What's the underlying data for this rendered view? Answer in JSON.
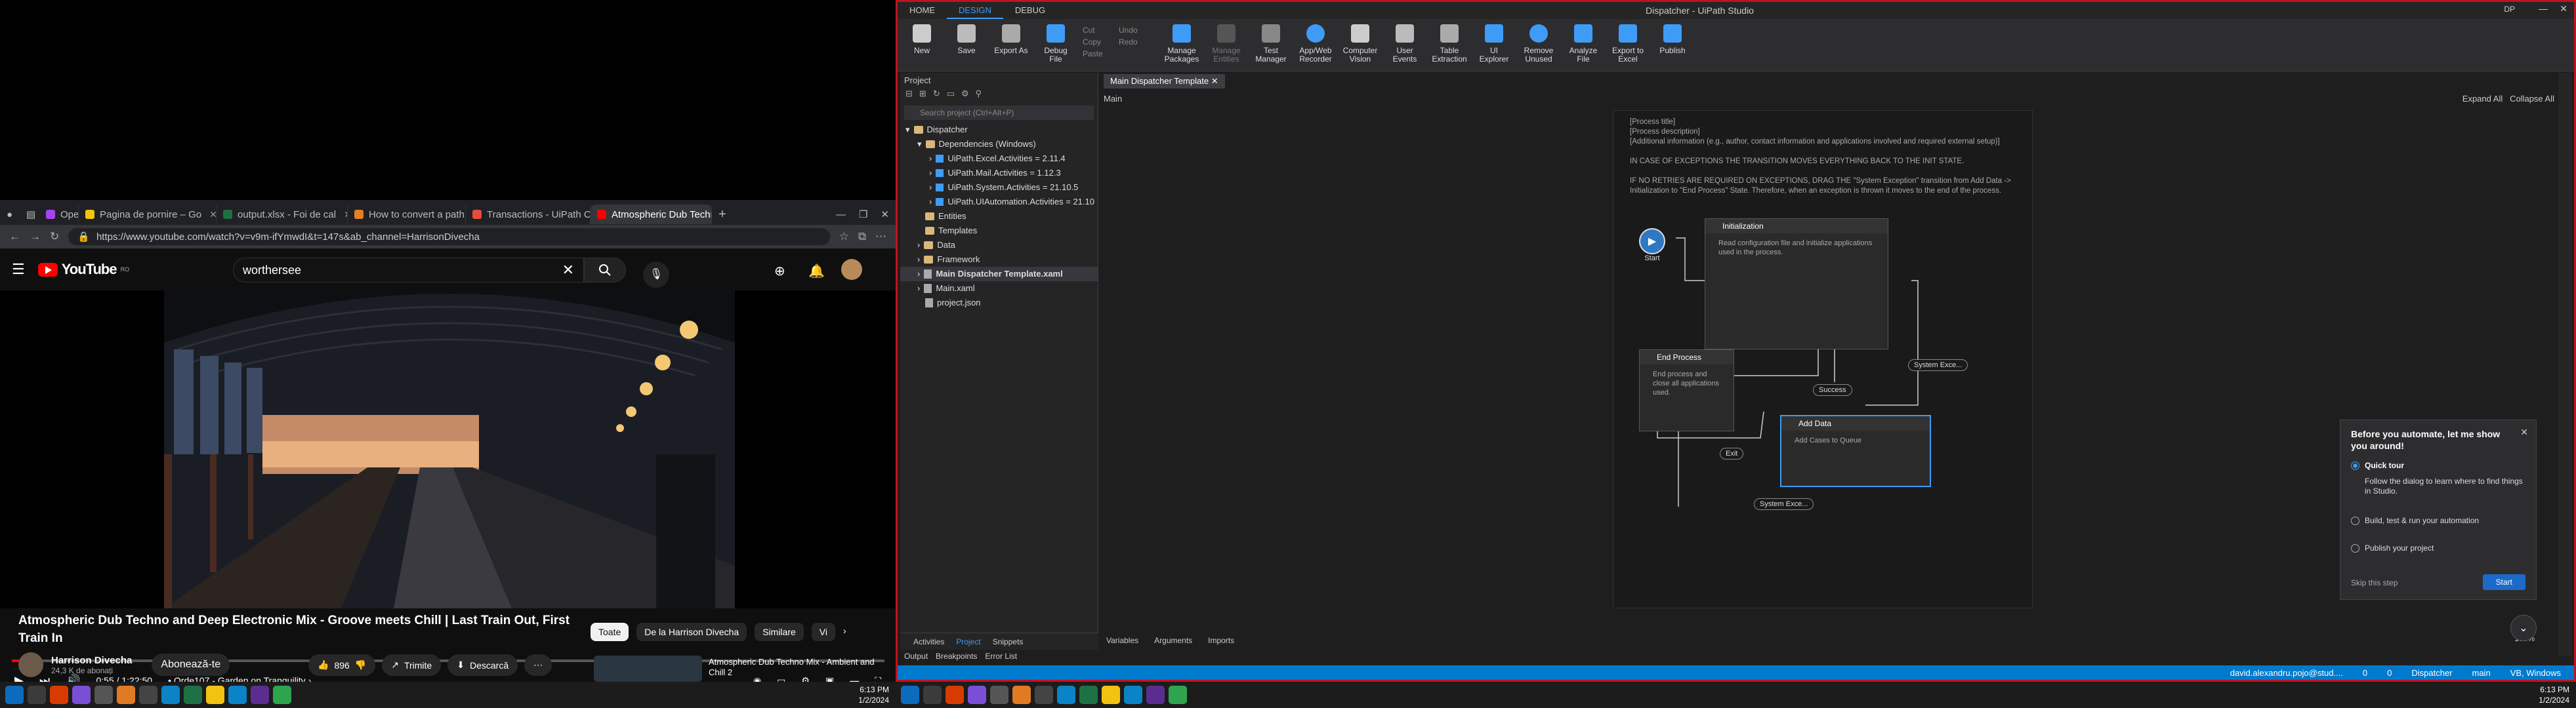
{
  "browser": {
    "tabs": [
      {
        "label": "OpenCV",
        "color": "#a742f5"
      },
      {
        "label": "Pagina de pornire – Go",
        "color": "#f1c40f"
      },
      {
        "label": "output.xlsx - Foi de cal",
        "color": "#1e7145"
      },
      {
        "label": "How to convert a path",
        "color": "#e67e22"
      },
      {
        "label": "Transactions - UiPath C",
        "color": "#e74c3c"
      },
      {
        "label": "Atmospheric Dub Techn",
        "color": "#ff0000"
      }
    ],
    "url": "https://www.youtube.com/watch?v=v9m-ifYmwdI&t=147s&ab_channel=HarrisonDivecha"
  },
  "youtube": {
    "logo": "YouTube",
    "country": "RO",
    "search_value": "worthersee",
    "time": "0:55 / 1:22:50",
    "chapter": "• Orde107 - Garden on Tranquility ›",
    "progress_fraction": 0.011,
    "title": "Atmospheric Dub Techno and Deep Electronic Mix - Groove meets Chill | Last Train Out, First Train In",
    "channel_name": "Harrison Divecha",
    "subscribers": "24,3 K de abonați",
    "subscribe_label": "Abonează-te",
    "likes": "896",
    "share_label": "Trimite",
    "download_label": "Descarcă",
    "chips": [
      "Toate",
      "De la Harrison Divecha",
      "Similare",
      "Vi"
    ],
    "next_title": "Atmospheric Dub Techno Mix - Ambient and Chill 2"
  },
  "taskbar_left": {
    "time": "6:13 PM",
    "date": "1/2/2024"
  },
  "studio": {
    "title": "Dispatcher - UiPath Studio",
    "ribbon_tabs": [
      "HOME",
      "DESIGN",
      "DEBUG"
    ],
    "user_initials": "DP",
    "ribbon_buttons": [
      {
        "label": "New",
        "dim": false
      },
      {
        "label": "Save",
        "dim": false
      },
      {
        "label": "Export As",
        "dim": false
      },
      {
        "label": "Debug File",
        "dim": false
      },
      {
        "label": "Manage Packages",
        "dim": false
      },
      {
        "label": "Manage Entities",
        "dim": true
      },
      {
        "label": "Test Manager",
        "dim": false
      },
      {
        "label": "App/Web Recorder",
        "dim": false
      },
      {
        "label": "Computer Vision",
        "dim": false
      },
      {
        "label": "User Events",
        "dim": false
      },
      {
        "label": "Table Extraction",
        "dim": false
      },
      {
        "label": "UI Explorer",
        "dim": false
      },
      {
        "label": "Remove Unused",
        "dim": false
      },
      {
        "label": "Analyze File",
        "dim": false
      },
      {
        "label": "Export to Excel",
        "dim": false
      },
      {
        "label": "Publish",
        "dim": false
      }
    ],
    "edit_small": [
      "Cut",
      "Copy",
      "Paste",
      "Undo",
      "Redo"
    ],
    "project_panel_title": "Project",
    "project_search_placeholder": "Search project (Ctrl+Alt+P)",
    "tree": [
      {
        "label": "Dispatcher",
        "indent": 0,
        "kind": "folder"
      },
      {
        "label": "Dependencies (Windows)",
        "indent": 1,
        "kind": "folder"
      },
      {
        "label": "UiPath.Excel.Activities = 2.11.4",
        "indent": 2,
        "kind": "pkg"
      },
      {
        "label": "UiPath.Mail.Activities = 1.12.3",
        "indent": 2,
        "kind": "pkg"
      },
      {
        "label": "UiPath.System.Activities = 21.10.5",
        "indent": 2,
        "kind": "pkg"
      },
      {
        "label": "UiPath.UIAutomation.Activities = 21.10",
        "indent": 2,
        "kind": "pkg"
      },
      {
        "label": "Entities",
        "indent": 1,
        "kind": "folder"
      },
      {
        "label": "Templates",
        "indent": 1,
        "kind": "folder"
      },
      {
        "label": "Data",
        "indent": 1,
        "kind": "folder"
      },
      {
        "label": "Framework",
        "indent": 1,
        "kind": "folder"
      },
      {
        "label": "Main Dispatcher Template.xaml",
        "indent": 1,
        "kind": "file",
        "selected": true
      },
      {
        "label": "Main.xaml",
        "indent": 1,
        "kind": "file"
      },
      {
        "label": "project.json",
        "indent": 1,
        "kind": "file"
      }
    ],
    "panel_tabs": [
      "Activities",
      "Project",
      "Snippets"
    ],
    "output_tabs": [
      "Output",
      "Breakpoints",
      "Error List"
    ],
    "doc_tab": "Main Dispatcher Template",
    "breadcrumb": "Main",
    "expand_all": "Expand All",
    "collapse_all": "Collapse All",
    "annotation_lines": [
      "[Process title]",
      "[Process description]",
      "[Additional information (e.g., author, contact information and applications involved and required external setup)]",
      "",
      "IN CASE OF EXCEPTIONS THE TRANSITION MOVES EVERYTHING BACK TO THE INIT STATE.",
      "",
      "IF NO RETRIES ARE REQUIRED ON EXCEPTIONS, DRAG THE \"System Exception\" transition from Add Data ->",
      "Initialization to \"End Process\" State. Therefore, when an exception is thrown it moves to the end of the process."
    ],
    "states": {
      "start": "Start",
      "initialization": {
        "title": "Initialization",
        "body": "Read configuration file and initialize applications used in the process."
      },
      "end_process": {
        "title": "End Process",
        "body": "End process and close all applications used."
      },
      "add_data": {
        "title": "Add Data",
        "body": "Add Cases to Queue"
      }
    },
    "transitions": {
      "success": "Success",
      "exit": "Exit",
      "sys1": "System Exce...",
      "sys2": "System Exce..."
    },
    "designer_tabs": [
      "Variables",
      "Arguments",
      "Imports"
    ],
    "zoom": "100%",
    "tour": {
      "title": "Before you automate, let me show you around!",
      "options": [
        {
          "label": "Quick tour",
          "desc": "Follow the dialog to learn where to find things in Studio.",
          "selected": true
        },
        {
          "label": "Build, test & run your automation",
          "desc": "",
          "selected": false
        },
        {
          "label": "Publish your project",
          "desc": "",
          "selected": false
        }
      ],
      "skip": "Skip this step",
      "start": "Start"
    },
    "status": {
      "account": "david.alexandru.pojo@stud....",
      "errors": "0",
      "warnings": "0",
      "project": "Dispatcher",
      "branch": "main",
      "target": "VB, Windows"
    }
  },
  "taskbar_right": {
    "time": "6:13 PM",
    "date": "1/2/2024"
  }
}
